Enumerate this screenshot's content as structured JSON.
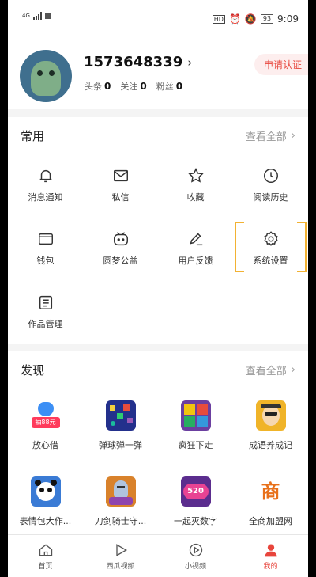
{
  "status_bar": {
    "network": "4G",
    "battery": "93",
    "time": "9:09",
    "hd": "HD"
  },
  "profile": {
    "phone": "1573648339",
    "certify_label": "申请认证",
    "stats": [
      {
        "label": "头条",
        "value": "0"
      },
      {
        "label": "关注",
        "value": "0"
      },
      {
        "label": "粉丝",
        "value": "0"
      }
    ]
  },
  "common": {
    "title": "常用",
    "more_label": "查看全部",
    "items": [
      {
        "label": "消息通知",
        "icon": "bell-icon"
      },
      {
        "label": "私信",
        "icon": "mail-icon"
      },
      {
        "label": "收藏",
        "icon": "star-icon"
      },
      {
        "label": "阅读历史",
        "icon": "clock-icon"
      },
      {
        "label": "钱包",
        "icon": "wallet-icon"
      },
      {
        "label": "圆梦公益",
        "icon": "charity-icon"
      },
      {
        "label": "用户反馈",
        "icon": "pen-icon"
      },
      {
        "label": "系统设置",
        "icon": "gear-icon"
      },
      {
        "label": "作品管理",
        "icon": "document-icon"
      }
    ]
  },
  "discover": {
    "title": "发现",
    "more_label": "查看全部",
    "items": [
      {
        "label": "放心借",
        "icon": "loan-app-icon",
        "badge": "抽88元"
      },
      {
        "label": "弹球弹一弹",
        "icon": "ball-game-icon"
      },
      {
        "label": "疯狂下走",
        "icon": "block-game-icon"
      },
      {
        "label": "成语养成记",
        "icon": "idiom-game-icon"
      },
      {
        "label": "表情包大作...",
        "icon": "panda-app-icon"
      },
      {
        "label": "刀剑骑士守...",
        "icon": "knight-game-icon"
      },
      {
        "label": "一起灭数字",
        "icon": "number-game-icon",
        "badge": "520"
      },
      {
        "label": "全商加盟网",
        "icon": "business-app-icon",
        "badge": "商"
      }
    ]
  },
  "tabbar": [
    {
      "label": "首页",
      "icon": "home-icon"
    },
    {
      "label": "西瓜视频",
      "icon": "play-icon"
    },
    {
      "label": "小视频",
      "icon": "small-video-icon"
    },
    {
      "label": "我的",
      "icon": "profile-icon",
      "active": true
    }
  ],
  "colors": {
    "accent": "#e8453c",
    "highlight": "#f2b233",
    "background": "#f4f4f4"
  }
}
